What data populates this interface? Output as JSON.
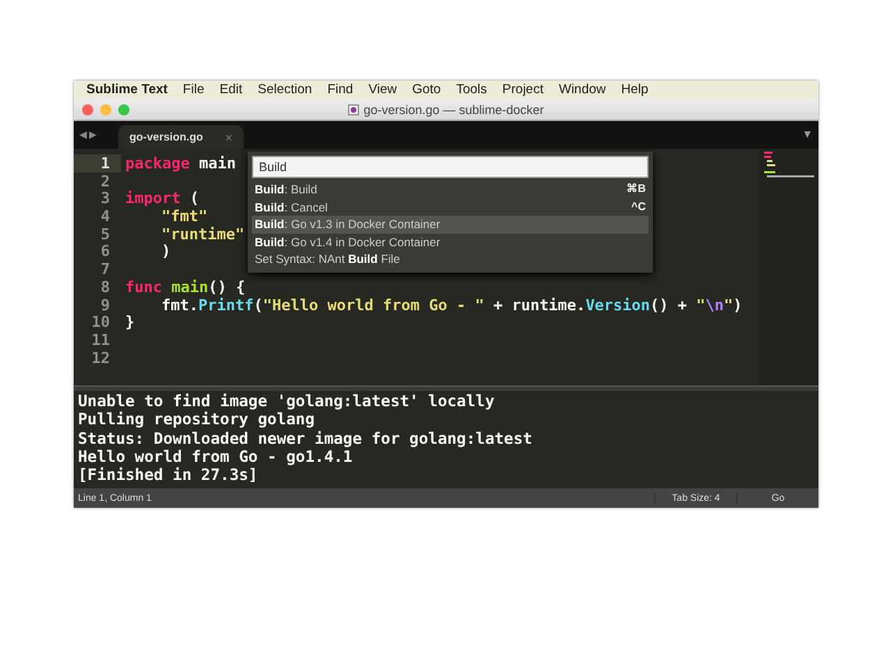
{
  "menu_bar": {
    "app_name": "Sublime Text",
    "items": [
      "File",
      "Edit",
      "Selection",
      "Find",
      "View",
      "Goto",
      "Tools",
      "Project",
      "Window",
      "Help"
    ]
  },
  "window": {
    "title": "go-version.go — sublime-docker"
  },
  "tab_bar": {
    "navigation": "◀ ▶",
    "dropdown": "▼"
  },
  "tabs": [
    {
      "label": "go-version.go",
      "selected": true,
      "close": "×"
    }
  ],
  "editor": {
    "lines": [
      {
        "number": "1",
        "current": true,
        "tokens": [
          {
            "text": "package",
            "kind": "keyword"
          },
          {
            "text": " main",
            "kind": "plain"
          }
        ]
      },
      {
        "number": "2",
        "current": false
      },
      {
        "number": "3",
        "current": false,
        "tokens": [
          {
            "text": "import",
            "kind": "keyword"
          },
          {
            "text": " (",
            "kind": "plain"
          }
        ]
      },
      {
        "number": "4",
        "current": false,
        "indented": true,
        "tokens": [
          {
            "text": "\"fmt\"",
            "kind": "string"
          }
        ]
      },
      {
        "number": "5",
        "current": false,
        "indented": true,
        "tokens": [
          {
            "text": "\"runtime\"",
            "kind": "string"
          }
        ]
      },
      {
        "number": "6",
        "current": false,
        "indented": true,
        "tokens": [
          {
            "text": ")",
            "kind": "plain"
          }
        ]
      },
      {
        "number": "7",
        "current": false
      },
      {
        "number": "8",
        "current": false,
        "tokens": [
          {
            "text": "func ",
            "kind": "keyword"
          },
          {
            "text": "main",
            "kind": "function"
          },
          {
            "text": "() {",
            "kind": "plain"
          }
        ]
      },
      {
        "number": "9",
        "current": false,
        "indented": true,
        "tokens": [
          {
            "text": "fmt.",
            "kind": "plain"
          },
          {
            "text": "Printf",
            "kind": "call"
          },
          {
            "text": "(",
            "kind": "plain"
          },
          {
            "text": "\"Hello world from Go - \"",
            "kind": "string"
          },
          {
            "text": " + runtime.",
            "kind": "plain"
          },
          {
            "text": "Version",
            "kind": "call"
          },
          {
            "text": "() + ",
            "kind": "plain"
          },
          {
            "text": "\"",
            "kind": "string"
          },
          {
            "text": "\\n",
            "kind": "escape"
          },
          {
            "text": "\"",
            "kind": "string"
          },
          {
            "text": ")",
            "kind": "plain"
          }
        ]
      },
      {
        "number": "10",
        "current": false,
        "tokens": [
          {
            "text": "}",
            "kind": "plain"
          }
        ]
      },
      {
        "number": "11",
        "current": false
      },
      {
        "number": "12",
        "current": false
      }
    ]
  },
  "command_palette": {
    "query": "Build",
    "items": [
      {
        "label": "**Build**: Build",
        "shortcut": "⌘B",
        "selected": false
      },
      {
        "label": "**Build**: Cancel",
        "shortcut": "^C",
        "selected": false
      },
      {
        "label": "**Build**: Go v1.3 in Docker Container",
        "selected": true
      },
      {
        "label": "**Build**: Go v1.4 in Docker Container",
        "selected": false
      },
      {
        "label": "Set Syntax: NAnt **Build** File",
        "selected": false
      }
    ]
  },
  "output": [
    "Unable to find image 'golang:latest' locally",
    "Pulling repository golang",
    "Status: Downloaded newer image for golang:latest",
    "Hello world from Go - go1.4.1",
    "[Finished in 27.3s]"
  ],
  "status_bar": {
    "position": "Line 1, Column 1",
    "tab_size": "Tab Size: 4",
    "syntax": "Go"
  }
}
